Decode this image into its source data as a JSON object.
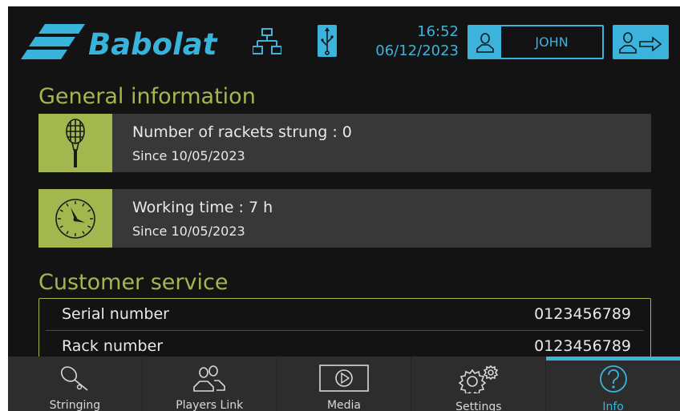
{
  "header": {
    "brand": "Babolat",
    "logo_icon": "babolat-logo-mark",
    "network_icon": "network-icon",
    "usb_icon": "usb-icon",
    "time": "16:52",
    "date": "06/12/2023",
    "user_icon": "user-icon",
    "user_name": "JOHN",
    "logout_icon": "user-logout-icon"
  },
  "general": {
    "title": "General information",
    "rackets": {
      "icon": "racket-icon",
      "main": "Number of rackets strung : 0",
      "since": "Since 10/05/2023"
    },
    "working": {
      "icon": "clock-icon",
      "main": "Working time : 7 h",
      "since": "Since 10/05/2023"
    }
  },
  "customer_service": {
    "title": "Customer service",
    "rows": [
      {
        "label": "Serial number",
        "value": "0123456789"
      },
      {
        "label": "Rack number",
        "value": "0123456789"
      }
    ]
  },
  "nav": {
    "items": [
      {
        "label": "Stringing",
        "icon": "racket-icon"
      },
      {
        "label": "Players Link",
        "icon": "players-icon"
      },
      {
        "label": "Media",
        "icon": "play-icon"
      },
      {
        "label": "Settings",
        "icon": "gears-icon"
      },
      {
        "label": "Info",
        "icon": "question-icon",
        "active": true
      }
    ]
  },
  "colors": {
    "accent_blue": "#3cb3dc",
    "accent_green": "#a2b84f",
    "background": "#131313",
    "card": "#383838"
  }
}
